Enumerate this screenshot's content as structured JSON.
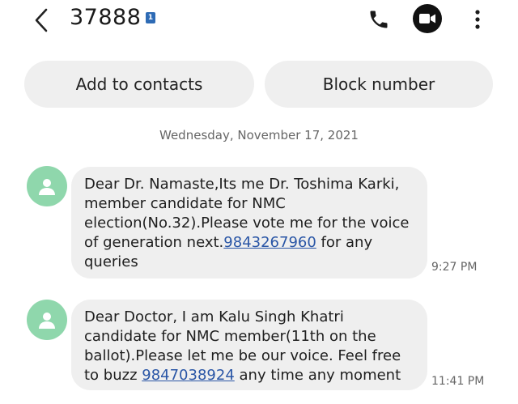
{
  "header": {
    "contact_number": "37888",
    "sim_badge": "1"
  },
  "actions": {
    "add_to_contacts": "Add to contacts",
    "block_number": "Block number"
  },
  "conversation": {
    "date": "Wednesday, November 17, 2021",
    "messages": [
      {
        "text_before_link": "Dear Dr. Namaste,Its me Dr. Toshima Karki, member candidate for NMC election(No.32).Please vote me for the voice of generation next.",
        "link": "9843267960",
        "text_after_link": " for any queries",
        "time": "9:27 PM"
      },
      {
        "text_before_link": "Dear Doctor, I am Kalu Singh Khatri candidate for NMC member(11th on the ballot).Please let me be our voice. Feel free to buzz ",
        "link": "9847038924",
        "text_after_link": " any time any moment",
        "time": "11:41 PM"
      }
    ]
  },
  "colors": {
    "avatar": "#8fd7ac",
    "bubble": "#efefef",
    "link": "#2a56a6",
    "sim_badge": "#2e6bb5"
  },
  "icons": {
    "back": "chevron-left-icon",
    "call": "phone-icon",
    "video": "video-camera-icon",
    "more": "more-vertical-icon",
    "avatar": "person-icon"
  }
}
